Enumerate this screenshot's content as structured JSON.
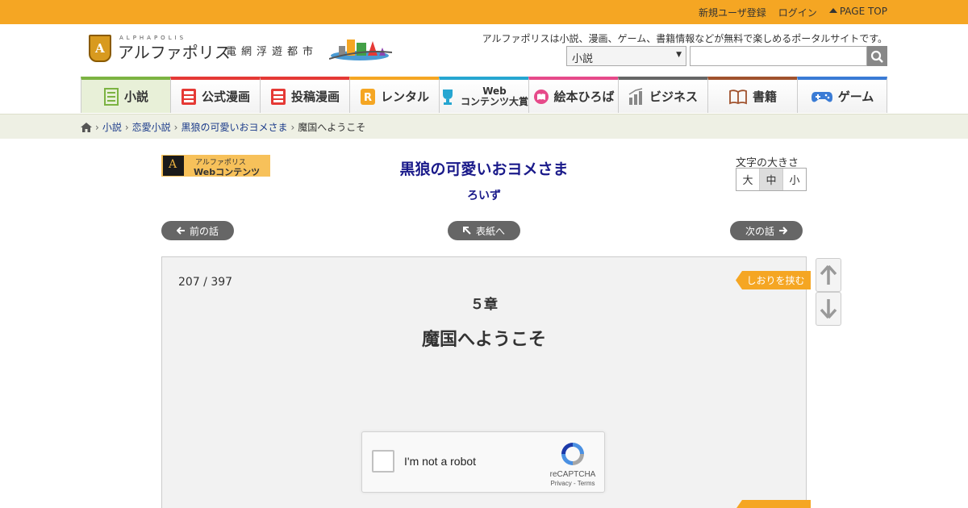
{
  "topbar": {
    "register": "新規ユーザ登録",
    "login": "ログイン",
    "page_top": "PAGE TOP",
    "color": "#f5a623"
  },
  "header": {
    "logo_small": "ALPHAPOLIS",
    "logo_big": "アルファポリス",
    "logo_sub": "電網浮遊都市",
    "tagline": "アルファポリスは小説、漫画、ゲーム、書籍情報などが無料で楽しめるポータルサイトです。",
    "search_category": "小説",
    "search_placeholder": "",
    "search_icon": "search-icon"
  },
  "nav": {
    "items": [
      {
        "label": "小説",
        "icon": "novel-icon",
        "color": "#7cb342"
      },
      {
        "label": "公式漫画",
        "icon": "official-manga-icon",
        "color": "#e53935"
      },
      {
        "label": "投稿漫画",
        "icon": "posted-manga-icon",
        "color": "#e53935"
      },
      {
        "label": "レンタル",
        "icon": "rental-icon",
        "color": "#f5a623"
      },
      {
        "label_line1": "Web",
        "label_line2": "コンテンツ大賞",
        "icon": "trophy-icon",
        "color": "#26a6d1"
      },
      {
        "label": "絵本ひろば",
        "icon": "picture-book-icon",
        "color": "#e64a8a"
      },
      {
        "label": "ビジネス",
        "icon": "business-icon",
        "color": "#666666"
      },
      {
        "label": "書籍",
        "icon": "book-icon",
        "color": "#a0522d"
      },
      {
        "label": "ゲーム",
        "icon": "game-icon",
        "color": "#3a7bd5"
      }
    ]
  },
  "breadcrumb": {
    "home_icon": "home-icon",
    "items": [
      "小説",
      "恋愛小説",
      "黒狼の可愛いおヨメさま"
    ],
    "current": "魔国へようこそ"
  },
  "content": {
    "badge_line1": "アルファポリス",
    "badge_line2": "Webコンテンツ",
    "title": "黒狼の可愛いおヨメさま",
    "author": "ろいず",
    "font_size_label": "文字の大きさ",
    "font_sizes": [
      "大",
      "中",
      "小"
    ],
    "font_size_selected": "中",
    "prev": "前の話",
    "toc": "表紙へ",
    "next": "次の話",
    "counter": "207 / 397",
    "chapter": "５章",
    "episode": "魔国へようこそ",
    "bookmark": "しおりを挟む"
  },
  "captcha": {
    "label": "I'm not a robot",
    "brand": "reCAPTCHA",
    "links": "Privacy - Terms"
  }
}
